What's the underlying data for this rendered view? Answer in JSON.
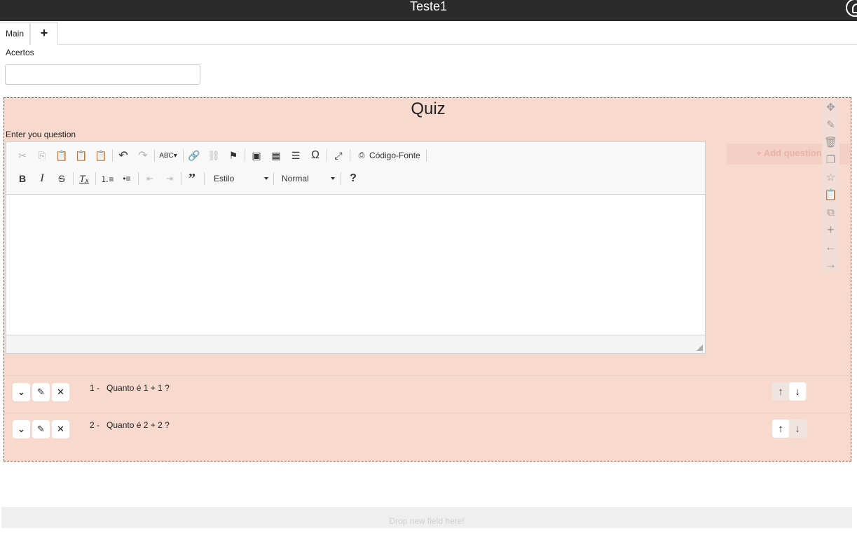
{
  "header": {
    "title": "Teste1",
    "user_icon": "user-circle-icon"
  },
  "tabs": [
    {
      "label": "Main"
    },
    {
      "label": "+"
    }
  ],
  "form": {
    "acertos_label": "Acertos",
    "acertos_value": ""
  },
  "quiz": {
    "title": "Quiz",
    "question_label": "Enter you question",
    "add_question_label": "+ Add question",
    "editor": {
      "source_label": "Código-Fonte",
      "style_combo": "Estilo",
      "format_combo": "Normal",
      "help_label": "?"
    },
    "questions": [
      {
        "number": "1 -",
        "text": "Quanto é 1 + 1 ?"
      },
      {
        "number": "2 -",
        "text": "Quanto é 2 + 2 ?"
      }
    ]
  },
  "dropzone": {
    "text": "Drop new field here!"
  },
  "colors": {
    "topbar": "#2b2b2b",
    "quiz_bg": "#f7d9ce",
    "quiz_border": "#9a4c3a"
  }
}
